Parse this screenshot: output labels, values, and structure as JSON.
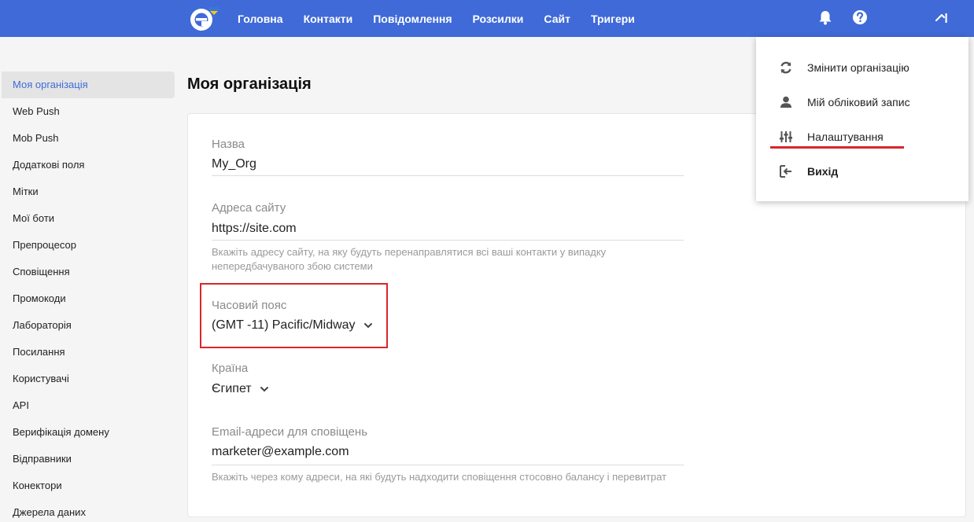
{
  "colors": {
    "accent": "#3f6ad8",
    "highlight": "#d9262b"
  },
  "nav": {
    "items": [
      {
        "label": "Головна",
        "name": "nav-home"
      },
      {
        "label": "Контакти",
        "name": "nav-contacts"
      },
      {
        "label": "Повідомлення",
        "name": "nav-messages"
      },
      {
        "label": "Розсилки",
        "name": "nav-campaigns"
      },
      {
        "label": "Сайт",
        "name": "nav-site"
      },
      {
        "label": "Тригери",
        "name": "nav-triggers"
      }
    ],
    "icons": [
      "bell-icon",
      "help-icon",
      "user-menu-icon"
    ]
  },
  "sidebar": {
    "items": [
      "Моя організація",
      "Web Push",
      "Mob Push",
      "Додаткові поля",
      "Мітки",
      "Мої боти",
      "Препроцесор",
      "Сповіщення",
      "Промокоди",
      "Лабораторія",
      "Посилання",
      "Користувачі",
      "API",
      "Верифікація домену",
      "Відправники",
      "Конектори",
      "Джерела даних"
    ],
    "active_index": 0
  },
  "page": {
    "title": "Моя організація"
  },
  "form": {
    "name": {
      "label": "Назва",
      "value": "My_Org"
    },
    "site": {
      "label": "Адреса сайту",
      "value": "https://site.com",
      "hint": "Вкажіть адресу сайту, на яку будуть перенаправлятися всі ваші контакти у випадку непередбачуваного збою системи"
    },
    "timezone": {
      "label": "Часовий пояс",
      "value": "(GMT -11) Pacific/Midway"
    },
    "country": {
      "label": "Країна",
      "value": "Єгипет"
    },
    "email": {
      "label": "Email-адреси для сповіщень",
      "value": "marketer@example.com",
      "hint": "Вкажіть через кому адреси, на які будуть надходити сповіщення стосовно балансу і перевитрат"
    }
  },
  "menu": {
    "items": [
      {
        "label": "Змінити організацію",
        "icon": "sync-icon"
      },
      {
        "label": "Мій обліковий запис",
        "icon": "person-icon"
      },
      {
        "label": "Налаштування",
        "icon": "sliders-icon"
      },
      {
        "label": "Вихід",
        "icon": "logout-icon"
      }
    ]
  }
}
